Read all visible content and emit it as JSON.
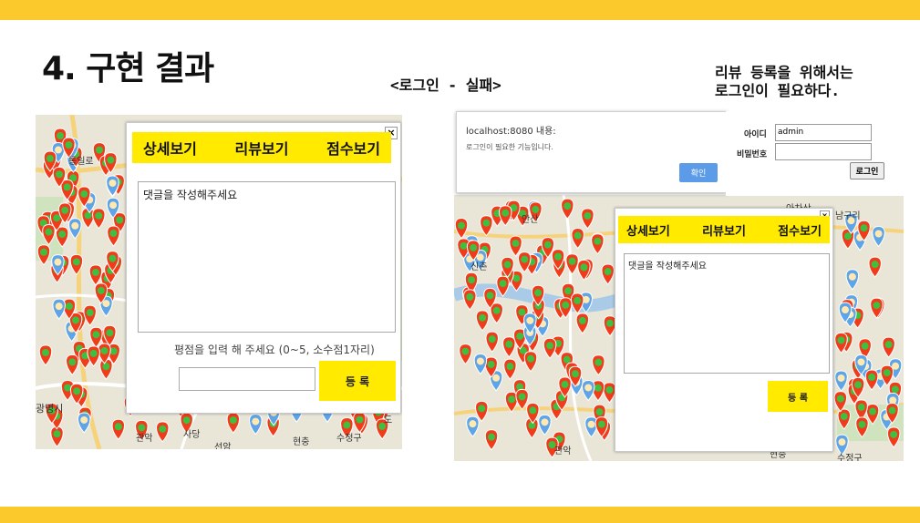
{
  "slide": {
    "title": "4. 구현 결과",
    "subtitle": "<로그인 - 실패>",
    "note_line1": "리뷰 등록을 위해서는",
    "note_line2": "로그인이 필요하다."
  },
  "colors": {
    "accent_band": "#fcc92c",
    "tab_yellow": "#ffea00",
    "alert_button": "#5b9be8",
    "pin_red": "#f13c1c",
    "pin_blue": "#5ea4e6"
  },
  "left_panel": {
    "map_labels": {
      "l1": "통일로",
      "l2": "광명시",
      "l3": "관악",
      "l4": "사당",
      "l5": "현충",
      "l6": "수정구",
      "l7": "도",
      "l8": "선암"
    },
    "popup": {
      "tabs": [
        "상세보기",
        "리뷰보기",
        "점수보기"
      ],
      "close": "×",
      "textarea_value": "댓글을 작성해주세요",
      "rating_hint": "평점을 입력 해 주세요 (0~5, 소수점1자리)",
      "score_value": "",
      "submit_label": "등 록"
    }
  },
  "right_panel": {
    "alert": {
      "title": "localhost:8080 내용:",
      "message": "로그인이 필요한 기능입니다.",
      "ok_label": "확인"
    },
    "login": {
      "id_label": "아이디",
      "id_value": "admin",
      "pw_label": "비밀번호",
      "pw_value": "",
      "button": "로그인"
    },
    "map_labels": {
      "r1": "안산",
      "r2": "아차산",
      "r3": "남구리",
      "r4": "관악",
      "r5": "현충",
      "r6": "수정구",
      "r7": "신촌"
    },
    "popup": {
      "tabs": [
        "상세보기",
        "리뷰보기",
        "점수보기"
      ],
      "close": "×",
      "textarea_value": "댓글을 작성해주세요",
      "submit_label": "등 록"
    }
  }
}
